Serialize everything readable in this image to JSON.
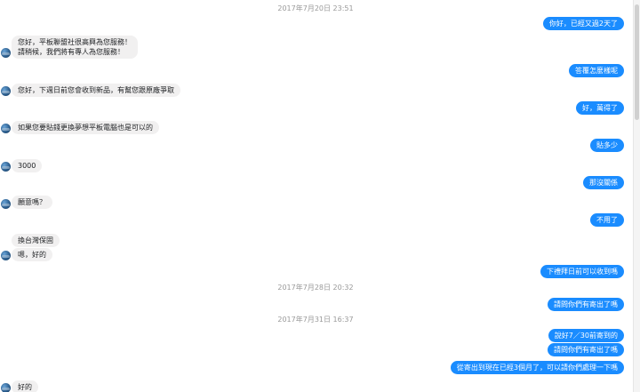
{
  "timestamps": [
    "2017年7月20日 23:51",
    "2017年7月28日 20:32",
    "2017年7月31日 16:37"
  ],
  "messages": {
    "m1": "你好，已經又過2天了",
    "m2_line1": "您好，平板聯盟社很高興為您服務！",
    "m2_line2": "請稍候，我們將有專人為您服務！",
    "m3": "答覆怎麼樣呢",
    "m4": "您好，下週日前您會收到新品，有幫您跟原廠爭取",
    "m5": "好，萬得了",
    "m6": "如果您要貼錢更換夢想平板電腦也是可以的",
    "m7": "貼多少",
    "m8": "3000",
    "m9": "那沒關係",
    "m10": "願意嗎？",
    "m11": "不用了",
    "m12": "換台灣保固",
    "m13": "嗯，好的",
    "m14": "下禮拜日前可以收到嗎",
    "m15": "請問你們有寄出了嗎",
    "m16": "說好7／30前寄到的",
    "m17": "請問你們有寄出了嗎",
    "m18": "從寄出到現在已經3個月了，可以請你們處理一下嗎",
    "m19": "好的"
  },
  "colors": {
    "outgoing_bubble": "#1a8cff",
    "incoming_bubble": "#f1f0f0",
    "timestamp": "#999999"
  }
}
